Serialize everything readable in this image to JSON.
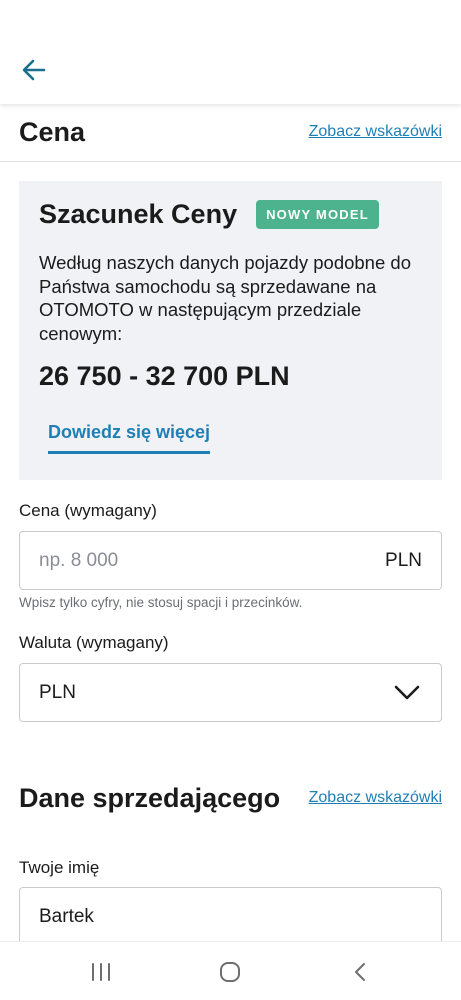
{
  "header": {
    "back_icon": "arrow-left-icon"
  },
  "price_section": {
    "title": "Cena",
    "hints_link": "Zobacz wskazówki"
  },
  "estimate": {
    "title": "Szacunek Ceny",
    "badge": "NOWY MODEL",
    "description": "Według naszych danych pojazdy podobne do Państwa samochodu są sprzedawane na OTOMOTO w następującym przedziale cenowym:",
    "range": "26 750 - 32 700 PLN",
    "learn_more": "Dowiedz się więcej"
  },
  "price_field": {
    "label": "Cena (wymagany)",
    "placeholder": "np. 8 000",
    "value": "",
    "suffix": "PLN",
    "helper": "Wpisz tylko cyfry, nie stosuj spacji i przecinków."
  },
  "currency_field": {
    "label": "Waluta (wymagany)",
    "value": "PLN",
    "options": [
      "PLN"
    ]
  },
  "seller_section": {
    "title": "Dane sprzedającego",
    "hints_link": "Zobacz wskazówki"
  },
  "name_field": {
    "label": "Twoje imię",
    "value": "Bartek"
  },
  "system_nav": {
    "icons": [
      "recent-apps-icon",
      "home-icon",
      "back-icon"
    ]
  },
  "colors": {
    "accent": "#1f7fb5",
    "badge": "#4db38f",
    "card_bg": "#f1f2f5",
    "back_arrow": "#1a6f8e"
  }
}
